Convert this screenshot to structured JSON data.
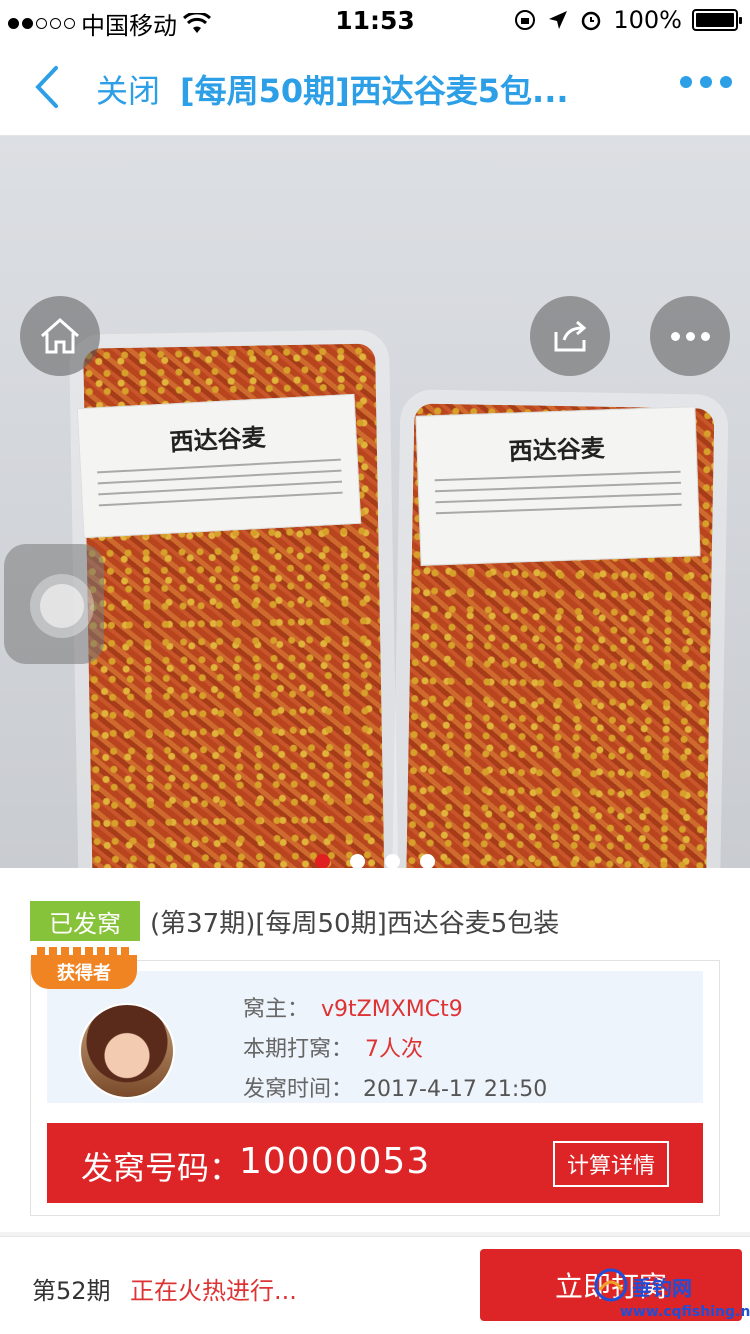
{
  "status_bar": {
    "carrier": "中国移动",
    "time": "11:53",
    "battery": "100%"
  },
  "nav": {
    "close_label": "关闭",
    "title": "[每周50期]西达谷麦5包..."
  },
  "product": {
    "label_text": "西达谷麦",
    "carousel_count": 4,
    "carousel_active": 1
  },
  "info": {
    "status_tag": "已发窝",
    "title": "(第37期)[每周50期]西达谷麦5包装"
  },
  "winner": {
    "badge": "获得者",
    "owner_label": "窝主：",
    "owner_value": "v9tZMXMCt9",
    "participants_label": "本期打窝：",
    "participants_value": "7人次",
    "time_label": "发窝时间：",
    "time_value": "2017-4-17 21:50",
    "number_label": "发窝号码：",
    "number_value": "10000053",
    "calc_button": "计算详情"
  },
  "bottom": {
    "period": "第52期",
    "hot_status": "正在火热进行...",
    "cta_label": "立即打窝"
  },
  "watermark": {
    "brand": "垂钓网",
    "url": "www.cqfishing.net"
  },
  "colors": {
    "accent_blue": "#2d9fe6",
    "brand_red": "#dd2527",
    "tag_green": "#87c33a",
    "badge_orange": "#f08422"
  }
}
